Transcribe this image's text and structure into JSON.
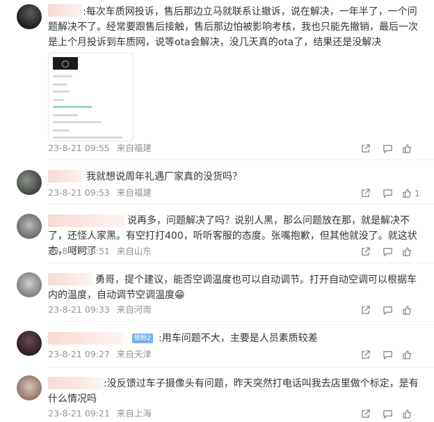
{
  "comments": [
    {
      "text": ":每次车质网投诉，售后那边立马就联系让撤诉，说在解决，一年半了，一个问题解决不了。经常要跟售后接触，售后那边怕被影响考核，我也只能先撤销，最后一次是上个月投诉到车质网，说等ota会解决，没几天真的ota了，结果还是没解决",
      "date": "23-8-21 09:55",
      "location": "来自福建",
      "likes": ""
    },
    {
      "text": "我就想说周年礼遇厂家真的没货吗？",
      "date": "23-8-21 09:53",
      "location": "来自福建",
      "likes": "1"
    },
    {
      "text": "说再多，问题解决了吗？说别人黑，那么问题放在那，就是解决不了，还怪人家黑。有空打打400，听听客服的态度。张嘴抱歉，但其他就没了。就这状态，呵呵了",
      "date": "23-8-21 09:51",
      "location": "来自山东",
      "likes": ""
    },
    {
      "text": "勇哥，提个建议，能否空调温度也可以自动调节。打开自动空调可以根据车内的温度，自动调节空调温度😁",
      "date": "23-8-21 09:33",
      "location": "来自河南",
      "likes": ""
    },
    {
      "text": ":用车问题不大，主要是人员素质较差",
      "date": "23-8-21 09:27",
      "location": "来自天津",
      "likes": "",
      "badge": "铁粉2"
    },
    {
      "text": ":没反馈过车子摄像头有问题，昨天突然打电话叫我去店里做个标定，是有什么情况吗",
      "date": "23-8-21 09:21",
      "location": "来自上海",
      "likes": ""
    }
  ],
  "colors": {
    "text": "#333333",
    "meta": "#939393",
    "icon": "#8a8a8a",
    "badge": "#7bb2ea"
  },
  "icons": [
    "share-icon",
    "comment-icon",
    "like-icon"
  ]
}
